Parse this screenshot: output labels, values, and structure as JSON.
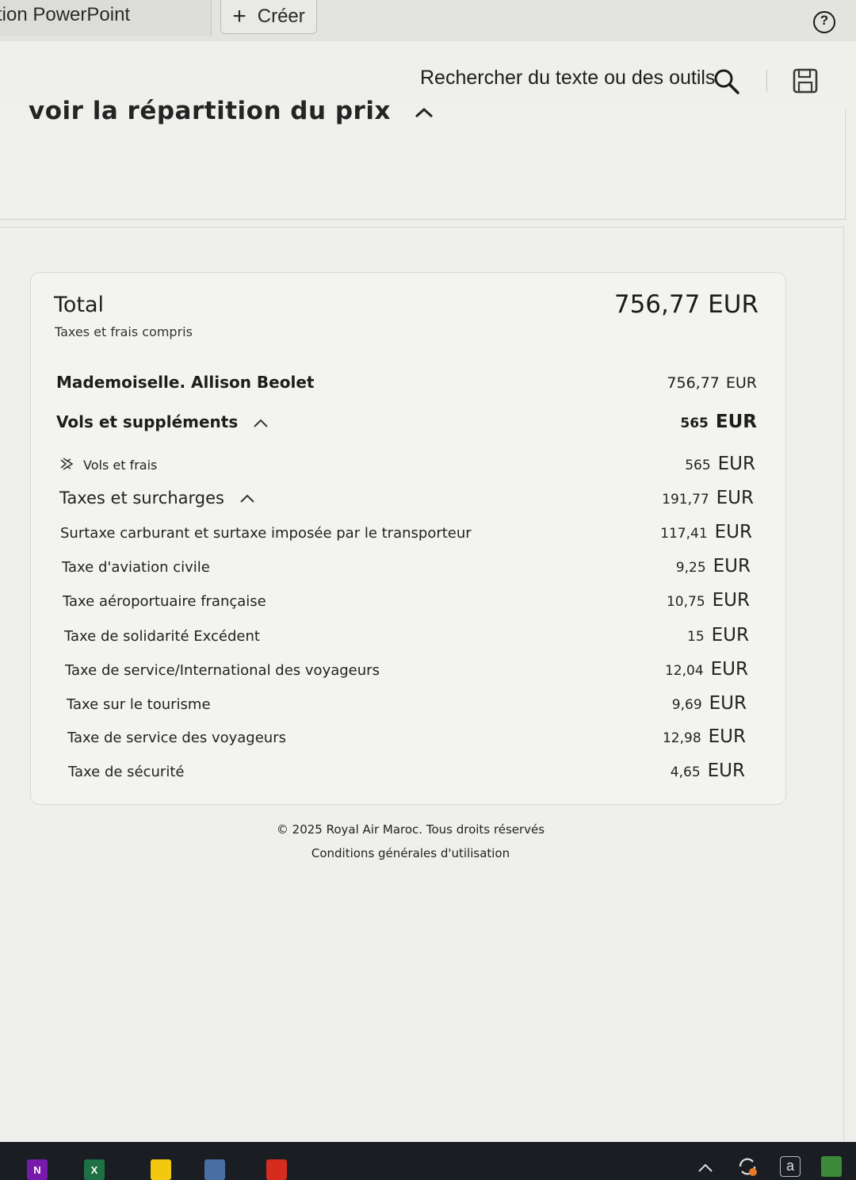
{
  "tabbar": {
    "app_tab_label": "tion PowerPoint",
    "create_label": "Créer"
  },
  "toolbar": {
    "search_label": "Rechercher du texte ou des outils"
  },
  "page": {
    "price_breakdown_heading": "voir la répartition du prix"
  },
  "price_card": {
    "total_label": "Total",
    "total_subtitle": "Taxes et frais compris",
    "total_amount": "756,77 EUR",
    "passenger": {
      "name": "Mademoiselle.  Allison Beolet",
      "amount": "756,77",
      "currency": "EUR"
    },
    "flights_section": {
      "label": "Vols et suppléments",
      "amount": "565",
      "currency": "EUR"
    },
    "flights_fees": {
      "label": "Vols et frais",
      "amount": "565",
      "currency": "EUR"
    },
    "taxes_section": {
      "label": "Taxes et surcharges",
      "amount": "191,77",
      "currency": "EUR"
    },
    "tax_lines": [
      {
        "label": "Surtaxe carburant et surtaxe imposée par le transporteur",
        "amount": "117,41",
        "currency": "EUR"
      },
      {
        "label": "Taxe d'aviation civile",
        "amount": "9,25",
        "currency": "EUR"
      },
      {
        "label": "Taxe aéroportuaire française",
        "amount": "10,75",
        "currency": "EUR"
      },
      {
        "label": "Taxe de solidarité Excédent",
        "amount": "15",
        "currency": "EUR"
      },
      {
        "label": "Taxe de service/International des voyageurs",
        "amount": "12,04",
        "currency": "EUR"
      },
      {
        "label": "Taxe sur le tourisme",
        "amount": "9,69",
        "currency": "EUR"
      },
      {
        "label": "Taxe de service des voyageurs",
        "amount": "12,98",
        "currency": "EUR"
      },
      {
        "label": "Taxe de sécurité",
        "amount": "4,65",
        "currency": "EUR"
      }
    ]
  },
  "footer": {
    "copyright": "© 2025 Royal Air Maroc. Tous droits réservés",
    "terms_link": "Conditions générales d'utilisation"
  },
  "taskbar": {
    "apps": [
      {
        "icon": "onenote-icon",
        "letter": "N",
        "color": "#7719aa"
      },
      {
        "icon": "excel-icon",
        "letter": "X",
        "color": "#1e7145"
      },
      {
        "icon": "powerbi-icon",
        "letter": "",
        "color": "#f2c811"
      },
      {
        "icon": "snipping-tool-icon",
        "letter": "",
        "color": "#4a6fa5"
      },
      {
        "icon": "acrobat-icon",
        "letter": "",
        "color": "#d62b1f"
      }
    ],
    "tray_letter": "a"
  }
}
